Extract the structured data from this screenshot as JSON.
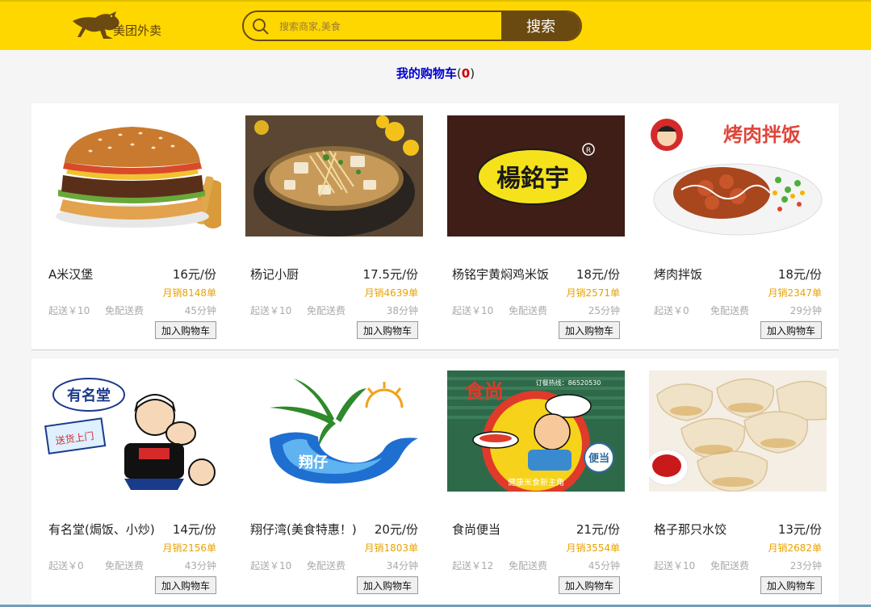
{
  "header": {
    "logo_text": "美团外卖",
    "search_placeholder": "搜索商家,美食",
    "search_button": "搜索"
  },
  "cart": {
    "label": "我的购物车",
    "open_paren": "(",
    "count": "0",
    "close_paren": ")"
  },
  "colors": {
    "header_bg": "#ffd700",
    "brand_brown": "#6b4a12",
    "sales_orange": "#e8a200",
    "cart_blue": "#0000cc"
  },
  "shops": [
    {
      "name": "A米汉堡",
      "price": "16元/份",
      "sales": "月销8148单",
      "min_order": "起送￥10",
      "delivery_fee": "免配送费",
      "time": "45分钟",
      "button": "加入购物车",
      "image": "burger"
    },
    {
      "name": "杨记小厨",
      "price": "17.5元/份",
      "sales": "月销4639单",
      "min_order": "起送￥10",
      "delivery_fee": "免配送费",
      "time": "38分钟",
      "button": "加入购物车",
      "image": "stone-pot-soup"
    },
    {
      "name": "杨铭宇黄焖鸡米饭",
      "price": "18元/份",
      "sales": "月销2571单",
      "min_order": "起送￥10",
      "delivery_fee": "免配送费",
      "time": "25分钟",
      "button": "加入购物车",
      "image": "yangmingyu-logo",
      "logo_text": "楊銘宇"
    },
    {
      "name": "烤肉拌饭",
      "price": "18元/份",
      "sales": "月销2347单",
      "min_order": "起送￥0",
      "delivery_fee": "免配送费",
      "time": "29分钟",
      "button": "加入购物车",
      "image": "bbq-rice",
      "logo_text": "烤肉拌饭"
    },
    {
      "name": "有名堂(焗饭、小炒)",
      "price": "14元/份",
      "sales": "月销2156单",
      "min_order": "起送￥0",
      "delivery_fee": "免配送费",
      "time": "43分钟",
      "button": "加入购物车",
      "image": "youmingtang-logo",
      "logo_text": "有名堂",
      "sign_text": "送货上门"
    },
    {
      "name": "翔仔湾(美食特惠！)",
      "price": "20元/份",
      "sales": "月销1803单",
      "min_order": "起送￥10",
      "delivery_fee": "免配送费",
      "time": "34分钟",
      "button": "加入购物车",
      "image": "xiangzaiwan-logo",
      "logo_text": "翔仔"
    },
    {
      "name": "食尚便当",
      "price": "21元/份",
      "sales": "月销3554单",
      "min_order": "起送￥12",
      "delivery_fee": "免配送费",
      "time": "45分钟",
      "button": "加入购物车",
      "image": "shishang-logo",
      "logo_text": "食尚",
      "sign_text": "订餐热线：86520530",
      "badge_text": "便当",
      "footer_text": "健康米食新主角"
    },
    {
      "name": "格子那只水饺",
      "price": "13元/份",
      "sales": "月销2682单",
      "min_order": "起送￥10",
      "delivery_fee": "免配送费",
      "time": "23分钟",
      "button": "加入购物车",
      "image": "dumplings"
    }
  ]
}
